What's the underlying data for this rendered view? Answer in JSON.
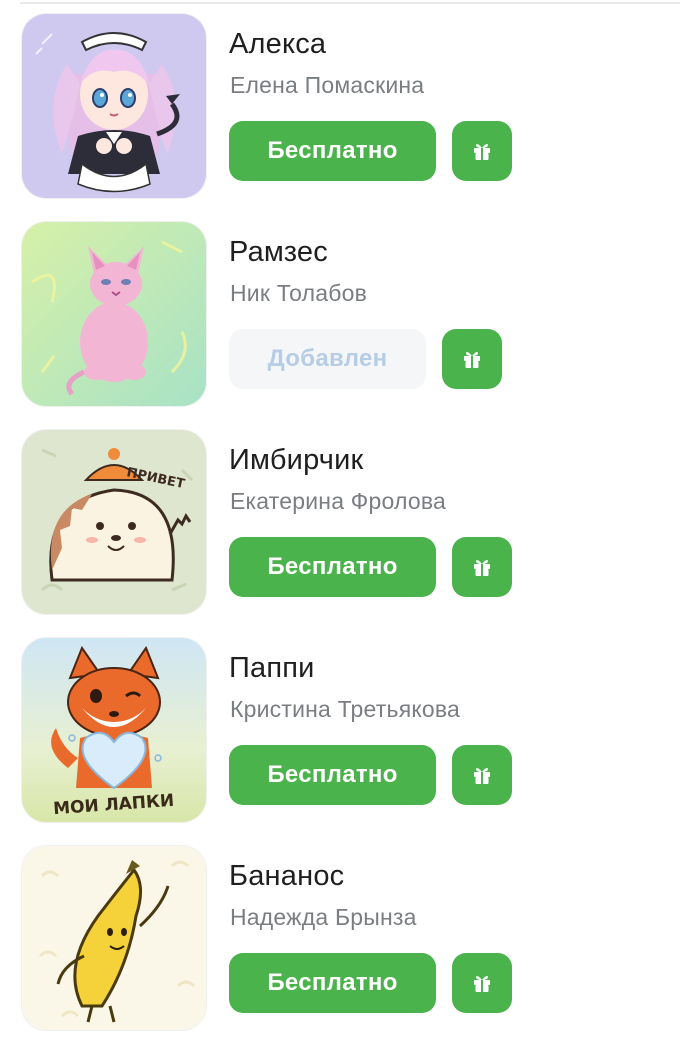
{
  "stickers": [
    {
      "title": "Алекса",
      "author": "Елена Помаскина",
      "action_label": "Бесплатно",
      "action_state": "free",
      "gift_icon": "gift-icon",
      "thumbnail": "anime-maid-girl-sticker"
    },
    {
      "title": "Рамзес",
      "author": "Ник Толабов",
      "action_label": "Добавлен",
      "action_state": "added",
      "gift_icon": "gift-icon",
      "thumbnail": "sphynx-cat-sticker"
    },
    {
      "title": "Имбирчик",
      "author": "Екатерина Фролова",
      "action_label": "Бесплатно",
      "action_state": "free",
      "gift_icon": "gift-icon",
      "thumbnail": "hedgehog-sticker",
      "thumbnail_text": "ПРИВЕТ"
    },
    {
      "title": "Паппи",
      "author": "Кристина Третьякова",
      "action_label": "Бесплатно",
      "action_state": "free",
      "gift_icon": "gift-icon",
      "thumbnail": "fox-sticker",
      "thumbnail_text": "МОИ ЛАПКИ"
    },
    {
      "title": "Бананос",
      "author": "Надежда Брынза",
      "action_label": "Бесплатно",
      "action_state": "free",
      "gift_icon": "gift-icon",
      "thumbnail": "banana-sticker"
    }
  ],
  "colors": {
    "accent_green": "#4bb34b",
    "added_bg": "#f5f6f8",
    "added_text": "#b7cde6",
    "title_text": "#1f1f1f",
    "author_text": "#7a7d82"
  }
}
